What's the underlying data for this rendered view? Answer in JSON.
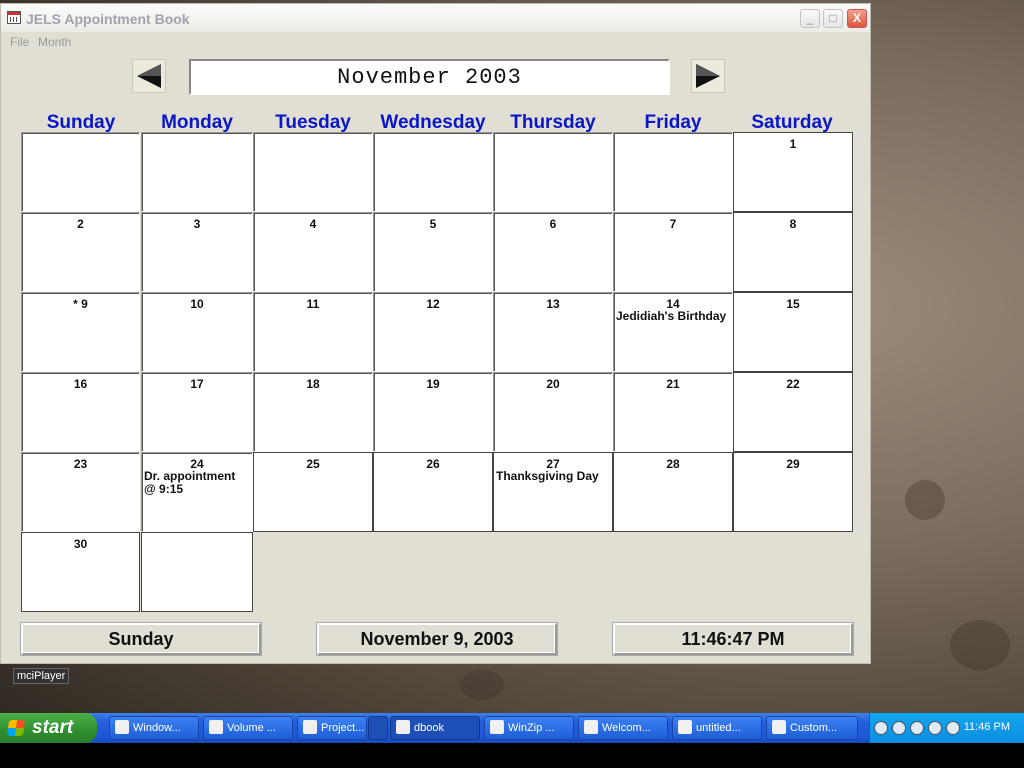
{
  "window": {
    "title": "JELS Appointment Book",
    "min": "_",
    "max": "□",
    "close": "X"
  },
  "menu": {
    "file": "File",
    "month": "Month"
  },
  "header": {
    "month_title": "November 2003"
  },
  "weekdays": [
    "Sunday",
    "Monday",
    "Tuesday",
    "Wednesday",
    "Thursday",
    "Friday",
    "Saturday"
  ],
  "calendar": {
    "days": {
      "1": "1",
      "2": "2",
      "3": "3",
      "4": "4",
      "5": "5",
      "6": "6",
      "7": "7",
      "8": "8",
      "9": "* 9",
      "10": "10",
      "11": "11",
      "12": "12",
      "13": "13",
      "14": "14",
      "15": "15",
      "16": "16",
      "17": "17",
      "18": "18",
      "19": "19",
      "20": "20",
      "21": "21",
      "22": "22",
      "23": "23",
      "24": "24",
      "25": "25",
      "26": "26",
      "27": "27",
      "28": "28",
      "29": "29",
      "30": "30"
    },
    "notes": {
      "14": "Jedidiah's Birthday",
      "24": "Dr. appointment @ 9:15",
      "27": "Thanksgiving Day"
    }
  },
  "status": {
    "weekday": "Sunday",
    "date": "November 9, 2003",
    "time": "11:46:47 PM"
  },
  "desktop": {
    "label": "mciPlayer"
  },
  "taskbar": {
    "start": "start",
    "tasks": [
      "Window...",
      "Volume ...",
      "Project...",
      "",
      "dbook",
      "WinZip ...",
      "Welcom...",
      "untitled...",
      "Custom..."
    ],
    "clock": "11:46 PM"
  }
}
